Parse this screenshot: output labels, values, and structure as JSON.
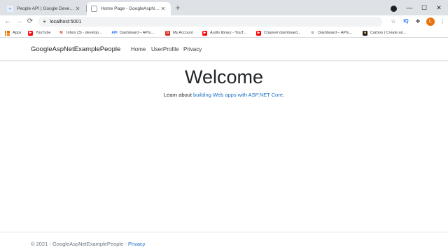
{
  "browser": {
    "tabs": [
      {
        "title": "People API  |  Google Developers",
        "active": false
      },
      {
        "title": "Home Page - GoogleAspNetExampl",
        "active": true
      }
    ],
    "new_tab": "+",
    "window_controls": {
      "minimize": "—",
      "maximize": "☐",
      "close": "✕"
    },
    "url": "localhost:5001",
    "profile_initial": "L",
    "bookmarks": [
      {
        "label": "Apps",
        "icon": "apps-grid-icon"
      },
      {
        "label": "YouTube",
        "icon": "youtube-icon"
      },
      {
        "label": "Inbox (3) - develop...",
        "icon": "gmail-icon"
      },
      {
        "label": "Dashboard – APIs...",
        "icon": "api-icon"
      },
      {
        "label": "My Account",
        "icon": "account-icon"
      },
      {
        "label": "Audio library - YouT...",
        "icon": "youtube-icon"
      },
      {
        "label": "Channel dashboard...",
        "icon": "youtube-icon"
      },
      {
        "label": "Dashboard – APIs...",
        "icon": "api-icon"
      },
      {
        "label": "Carbon | Create an...",
        "icon": "carbon-icon"
      }
    ]
  },
  "site": {
    "brand": "GoogleAspNetExamplePeople",
    "nav": [
      "Home",
      "UserProfile",
      "Privacy"
    ],
    "heading": "Welcome",
    "learn_prefix": "Learn about ",
    "learn_link": "building Web apps with ASP.NET Core",
    "learn_suffix": ".",
    "footer_prefix": "© 2021 - GoogleAspNetExamplePeople - ",
    "footer_link": "Privacy"
  },
  "colors": {
    "link": "#1b6ec2",
    "tabstrip": "#dee1e6",
    "text": "#212529",
    "muted": "#6c757d"
  }
}
